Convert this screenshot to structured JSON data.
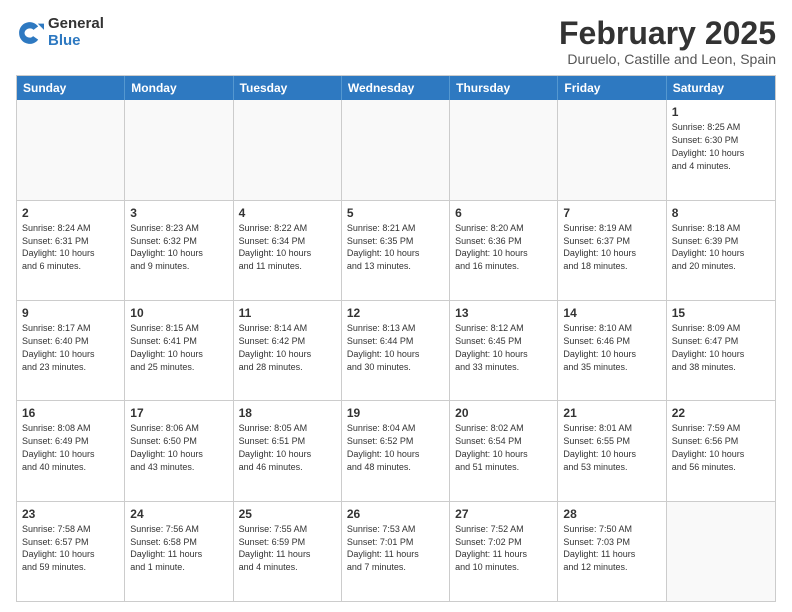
{
  "logo": {
    "general": "General",
    "blue": "Blue"
  },
  "title": "February 2025",
  "subtitle": "Duruelo, Castille and Leon, Spain",
  "header_days": [
    "Sunday",
    "Monday",
    "Tuesday",
    "Wednesday",
    "Thursday",
    "Friday",
    "Saturday"
  ],
  "weeks": [
    [
      {
        "day": "",
        "text": ""
      },
      {
        "day": "",
        "text": ""
      },
      {
        "day": "",
        "text": ""
      },
      {
        "day": "",
        "text": ""
      },
      {
        "day": "",
        "text": ""
      },
      {
        "day": "",
        "text": ""
      },
      {
        "day": "1",
        "text": "Sunrise: 8:25 AM\nSunset: 6:30 PM\nDaylight: 10 hours\nand 4 minutes."
      }
    ],
    [
      {
        "day": "2",
        "text": "Sunrise: 8:24 AM\nSunset: 6:31 PM\nDaylight: 10 hours\nand 6 minutes."
      },
      {
        "day": "3",
        "text": "Sunrise: 8:23 AM\nSunset: 6:32 PM\nDaylight: 10 hours\nand 9 minutes."
      },
      {
        "day": "4",
        "text": "Sunrise: 8:22 AM\nSunset: 6:34 PM\nDaylight: 10 hours\nand 11 minutes."
      },
      {
        "day": "5",
        "text": "Sunrise: 8:21 AM\nSunset: 6:35 PM\nDaylight: 10 hours\nand 13 minutes."
      },
      {
        "day": "6",
        "text": "Sunrise: 8:20 AM\nSunset: 6:36 PM\nDaylight: 10 hours\nand 16 minutes."
      },
      {
        "day": "7",
        "text": "Sunrise: 8:19 AM\nSunset: 6:37 PM\nDaylight: 10 hours\nand 18 minutes."
      },
      {
        "day": "8",
        "text": "Sunrise: 8:18 AM\nSunset: 6:39 PM\nDaylight: 10 hours\nand 20 minutes."
      }
    ],
    [
      {
        "day": "9",
        "text": "Sunrise: 8:17 AM\nSunset: 6:40 PM\nDaylight: 10 hours\nand 23 minutes."
      },
      {
        "day": "10",
        "text": "Sunrise: 8:15 AM\nSunset: 6:41 PM\nDaylight: 10 hours\nand 25 minutes."
      },
      {
        "day": "11",
        "text": "Sunrise: 8:14 AM\nSunset: 6:42 PM\nDaylight: 10 hours\nand 28 minutes."
      },
      {
        "day": "12",
        "text": "Sunrise: 8:13 AM\nSunset: 6:44 PM\nDaylight: 10 hours\nand 30 minutes."
      },
      {
        "day": "13",
        "text": "Sunrise: 8:12 AM\nSunset: 6:45 PM\nDaylight: 10 hours\nand 33 minutes."
      },
      {
        "day": "14",
        "text": "Sunrise: 8:10 AM\nSunset: 6:46 PM\nDaylight: 10 hours\nand 35 minutes."
      },
      {
        "day": "15",
        "text": "Sunrise: 8:09 AM\nSunset: 6:47 PM\nDaylight: 10 hours\nand 38 minutes."
      }
    ],
    [
      {
        "day": "16",
        "text": "Sunrise: 8:08 AM\nSunset: 6:49 PM\nDaylight: 10 hours\nand 40 minutes."
      },
      {
        "day": "17",
        "text": "Sunrise: 8:06 AM\nSunset: 6:50 PM\nDaylight: 10 hours\nand 43 minutes."
      },
      {
        "day": "18",
        "text": "Sunrise: 8:05 AM\nSunset: 6:51 PM\nDaylight: 10 hours\nand 46 minutes."
      },
      {
        "day": "19",
        "text": "Sunrise: 8:04 AM\nSunset: 6:52 PM\nDaylight: 10 hours\nand 48 minutes."
      },
      {
        "day": "20",
        "text": "Sunrise: 8:02 AM\nSunset: 6:54 PM\nDaylight: 10 hours\nand 51 minutes."
      },
      {
        "day": "21",
        "text": "Sunrise: 8:01 AM\nSunset: 6:55 PM\nDaylight: 10 hours\nand 53 minutes."
      },
      {
        "day": "22",
        "text": "Sunrise: 7:59 AM\nSunset: 6:56 PM\nDaylight: 10 hours\nand 56 minutes."
      }
    ],
    [
      {
        "day": "23",
        "text": "Sunrise: 7:58 AM\nSunset: 6:57 PM\nDaylight: 10 hours\nand 59 minutes."
      },
      {
        "day": "24",
        "text": "Sunrise: 7:56 AM\nSunset: 6:58 PM\nDaylight: 11 hours\nand 1 minute."
      },
      {
        "day": "25",
        "text": "Sunrise: 7:55 AM\nSunset: 6:59 PM\nDaylight: 11 hours\nand 4 minutes."
      },
      {
        "day": "26",
        "text": "Sunrise: 7:53 AM\nSunset: 7:01 PM\nDaylight: 11 hours\nand 7 minutes."
      },
      {
        "day": "27",
        "text": "Sunrise: 7:52 AM\nSunset: 7:02 PM\nDaylight: 11 hours\nand 10 minutes."
      },
      {
        "day": "28",
        "text": "Sunrise: 7:50 AM\nSunset: 7:03 PM\nDaylight: 11 hours\nand 12 minutes."
      },
      {
        "day": "",
        "text": ""
      }
    ]
  ]
}
